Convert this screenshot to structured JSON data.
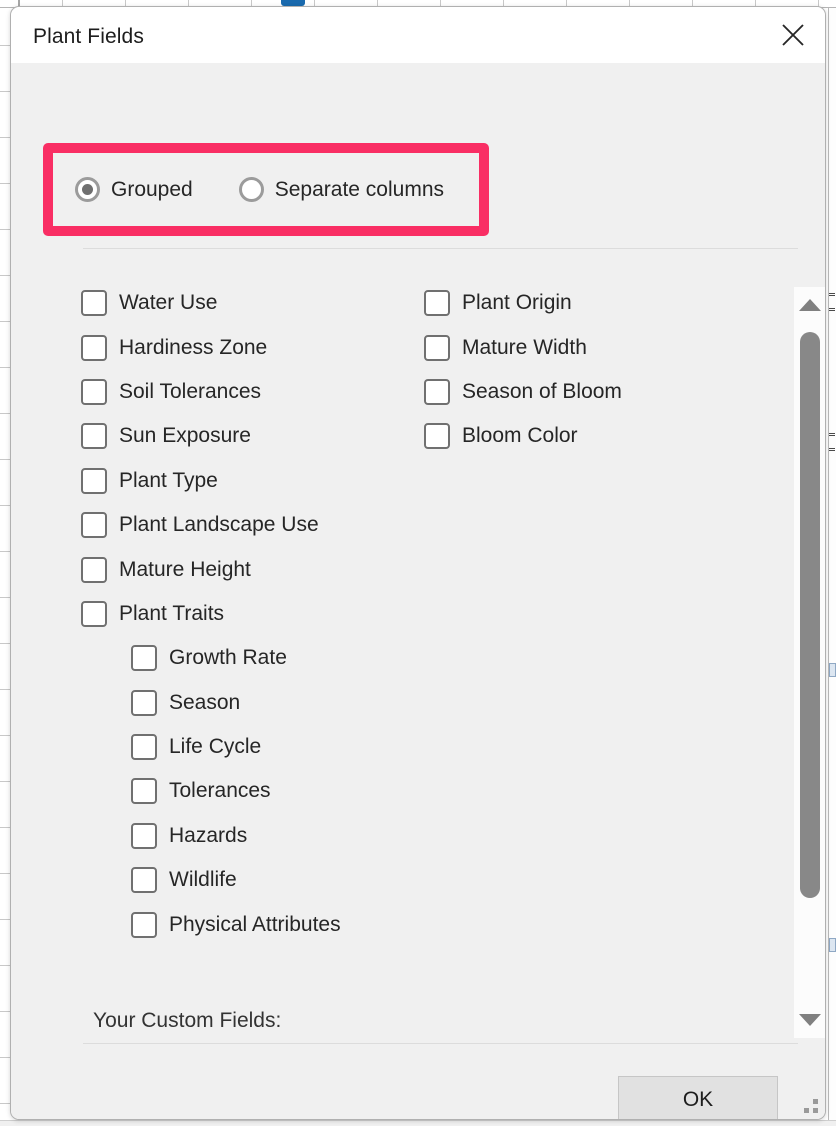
{
  "window": {
    "title": "Plant Fields",
    "close_icon": "close-icon"
  },
  "layout_options": {
    "highlighted": true,
    "highlight_color": "#f92e64",
    "selected": "Grouped",
    "options": [
      {
        "label": "Grouped",
        "checked": true
      },
      {
        "label": "Separate columns",
        "checked": false
      }
    ]
  },
  "fields": {
    "left_column": [
      {
        "label": "Water Use",
        "checked": false,
        "indent": false
      },
      {
        "label": "Hardiness Zone",
        "checked": false,
        "indent": false
      },
      {
        "label": "Soil Tolerances",
        "checked": false,
        "indent": false
      },
      {
        "label": "Sun Exposure",
        "checked": false,
        "indent": false
      },
      {
        "label": "Plant Type",
        "checked": false,
        "indent": false
      },
      {
        "label": "Plant Landscape Use",
        "checked": false,
        "indent": false
      },
      {
        "label": "Mature Height",
        "checked": false,
        "indent": false
      },
      {
        "label": "Plant Traits",
        "checked": false,
        "indent": false
      },
      {
        "label": "Growth Rate",
        "checked": false,
        "indent": true
      },
      {
        "label": "Season",
        "checked": false,
        "indent": true
      },
      {
        "label": "Life Cycle",
        "checked": false,
        "indent": true
      },
      {
        "label": "Tolerances",
        "checked": false,
        "indent": true
      },
      {
        "label": "Hazards",
        "checked": false,
        "indent": true
      },
      {
        "label": "Wildlife",
        "checked": false,
        "indent": true
      },
      {
        "label": "Physical Attributes",
        "checked": false,
        "indent": true
      }
    ],
    "right_column": [
      {
        "label": "Plant Origin",
        "checked": false,
        "indent": false
      },
      {
        "label": "Mature Width",
        "checked": false,
        "indent": false
      },
      {
        "label": "Season of Bloom",
        "checked": false,
        "indent": false
      },
      {
        "label": "Bloom Color",
        "checked": false,
        "indent": false
      }
    ]
  },
  "custom_fields": {
    "label": "Your Custom Fields:"
  },
  "scrollbar": {
    "up_arrow_icon": "triangle-up-icon",
    "down_arrow_icon": "triangle-down-icon",
    "thumb_position_percent": 6,
    "thumb_size_percent": 82
  },
  "footer": {
    "ok_label": "OK"
  },
  "resize_grip": "resize-grip-icon"
}
